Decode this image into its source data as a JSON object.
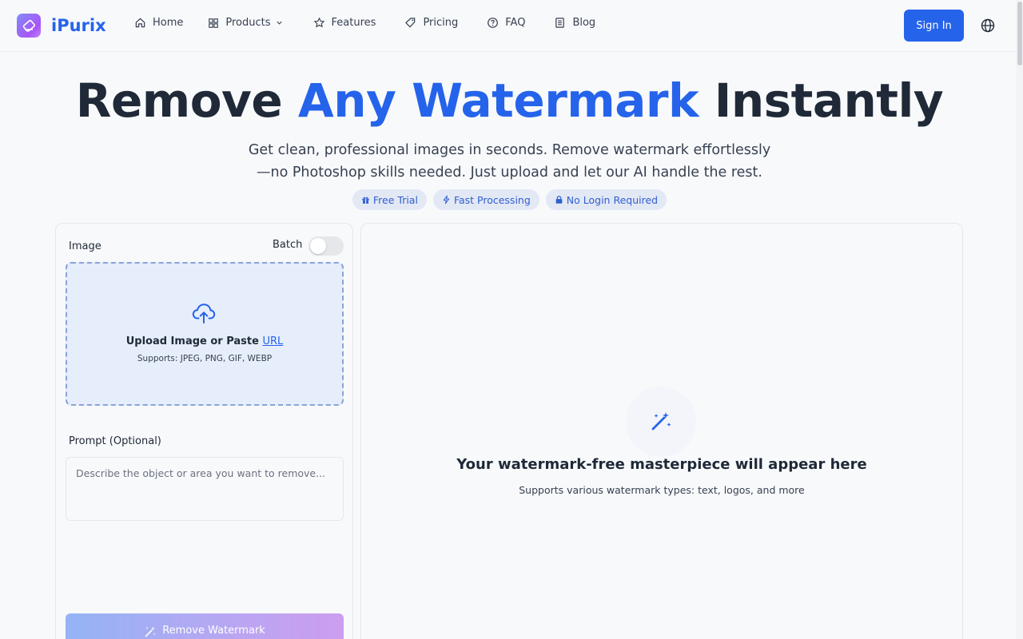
{
  "brand": {
    "name": "iPurix",
    "accent": "#2563eb"
  },
  "nav": {
    "items": [
      {
        "label": "Home",
        "icon": "home-icon"
      },
      {
        "label": "Products",
        "icon": "grid-icon",
        "dropdown": true
      },
      {
        "label": "Features",
        "icon": "star-icon"
      },
      {
        "label": "Pricing",
        "icon": "tag-icon"
      },
      {
        "label": "FAQ",
        "icon": "help-circle-icon"
      },
      {
        "label": "Blog",
        "icon": "document-icon"
      }
    ],
    "sign_in": "Sign In",
    "language_icon": "globe-icon"
  },
  "hero": {
    "title_start": "Remove ",
    "title_accent": "Any Watermark",
    "title_end": " Instantly",
    "subtitle_line1": "Get clean, professional images in seconds. Remove watermark effortlessly",
    "subtitle_line2": "—no Photoshop skills needed. Just upload and let our AI handle the rest.",
    "badges": [
      {
        "label": "Free Trial",
        "icon": "gift-icon"
      },
      {
        "label": "Fast Processing",
        "icon": "lightning-icon"
      },
      {
        "label": "No Login Required",
        "icon": "lock-icon"
      }
    ]
  },
  "editor": {
    "image_label": "Image",
    "batch_label": "Batch",
    "batch_enabled": false,
    "upload_text": "Upload Image or Paste ",
    "upload_link": "URL",
    "upload_support": "Supports: JPEG, PNG, GIF, WEBP",
    "prompt_label": "Prompt (Optional)",
    "prompt_placeholder": "Describe the object or area you want to remove...",
    "prompt_value": "",
    "submit_label": "Remove Watermark"
  },
  "result": {
    "title": "Your watermark-free masterpiece will appear here",
    "subtitle": "Supports various watermark types: text, logos, and more"
  }
}
